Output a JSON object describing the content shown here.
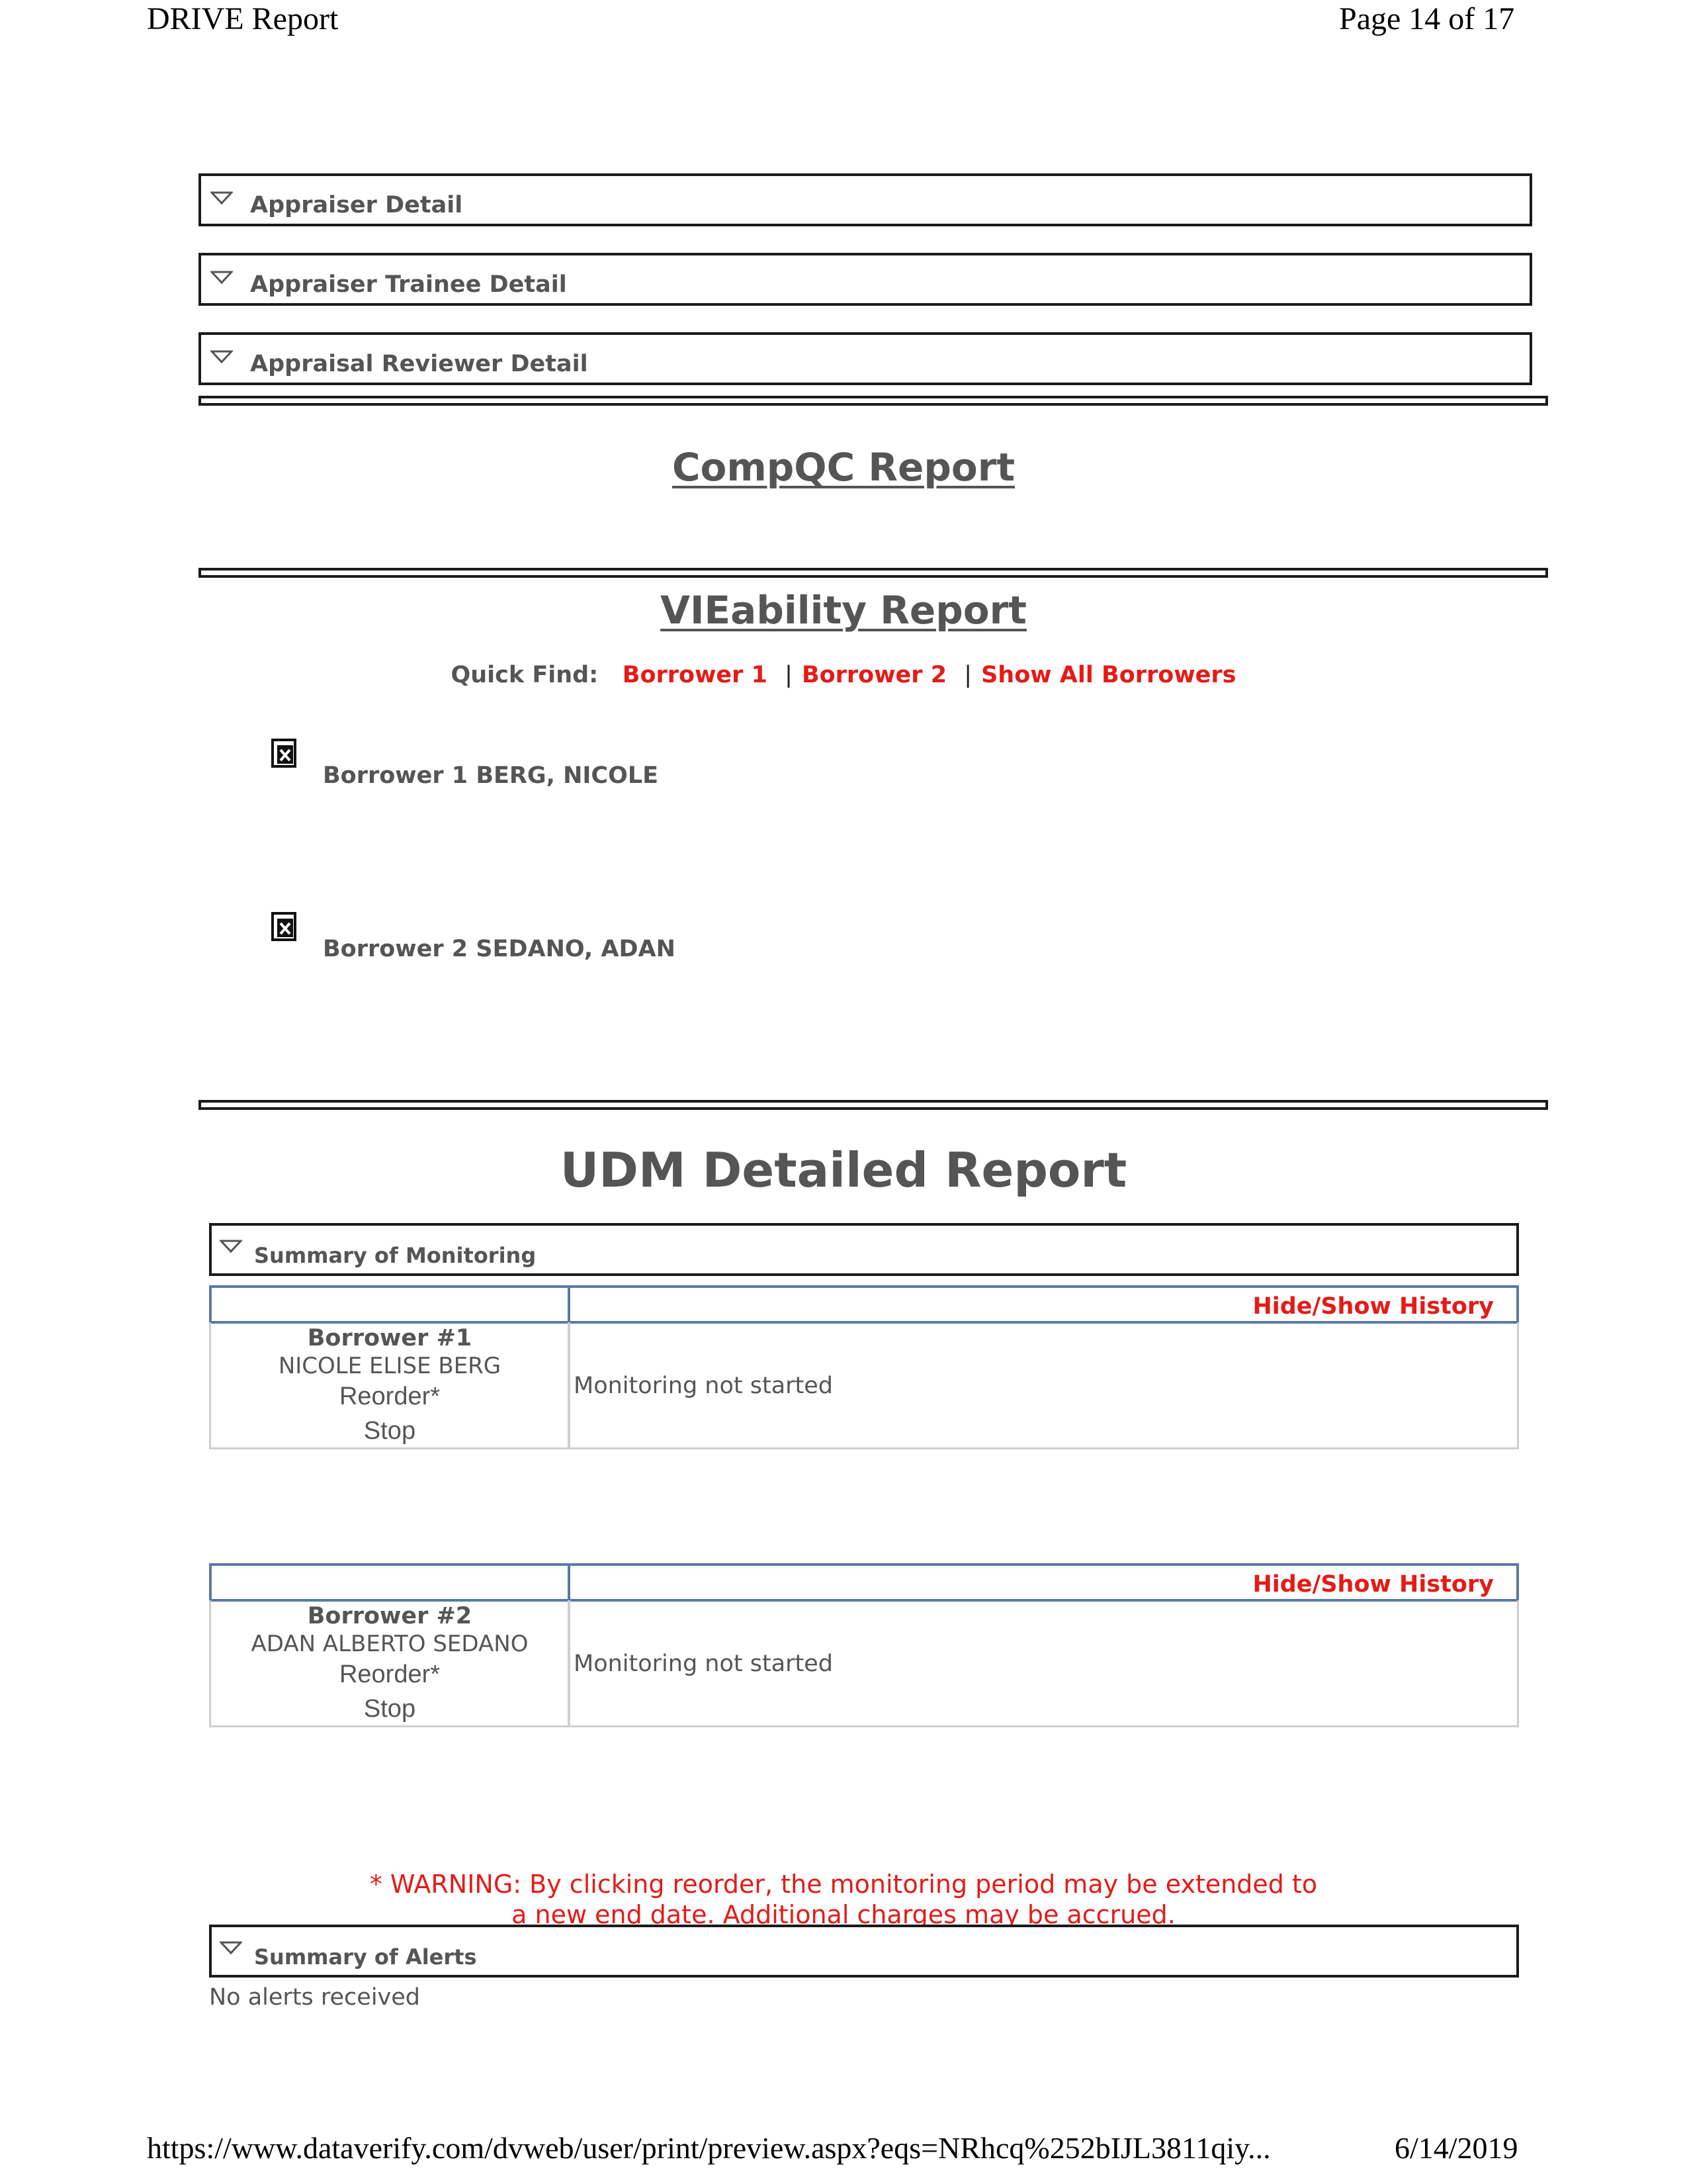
{
  "page_header": {
    "left": "DRIVE Report",
    "right": "Page 14 of 17"
  },
  "sections": [
    {
      "label": "Appraiser Detail"
    },
    {
      "label": "Appraiser Trainee Detail"
    },
    {
      "label": "Appraisal Reviewer Detail"
    }
  ],
  "compqc_title": "CompQC Report",
  "vieability": {
    "title": "VIEability Report",
    "quick_find_label": "Quick Find:",
    "links": [
      "Borrower 1",
      "Borrower 2",
      "Show All Borrowers"
    ],
    "separator": "|",
    "borrowers": [
      "Borrower 1 BERG, NICOLE",
      "Borrower 2 SEDANO, ADAN"
    ]
  },
  "udm": {
    "title": "UDM Detailed Report",
    "summary_label": "Summary of Monitoring",
    "hide_show": "Hide/Show History",
    "borrowers": [
      {
        "number": "Borrower #1",
        "name": "NICOLE ELISE BERG",
        "reorder": "Reorder*",
        "stop": "Stop",
        "status": "Monitoring not started"
      },
      {
        "number": "Borrower #2",
        "name": "ADAN ALBERTO SEDANO",
        "reorder": "Reorder*",
        "stop": "Stop",
        "status": "Monitoring not started"
      }
    ],
    "warning_line1": "* WARNING: By clicking reorder, the monitoring period may be extended to",
    "warning_line2": "a new end date. Additional charges may be accrued.",
    "alerts_label": "Summary of Alerts",
    "no_alerts": "No alerts received"
  },
  "page_footer": {
    "url": "https://www.dataverify.com/dvweb/user/print/preview.aspx?eqs=NRhcq%252bIJL3811qiy...",
    "date": "6/14/2019"
  },
  "colors": {
    "link_red": "#e41b17",
    "text_gray": "#555555",
    "table_border_blue": "#5a7aa8"
  },
  "icons": [
    "chevron-down-icon",
    "broken-image-icon"
  ]
}
